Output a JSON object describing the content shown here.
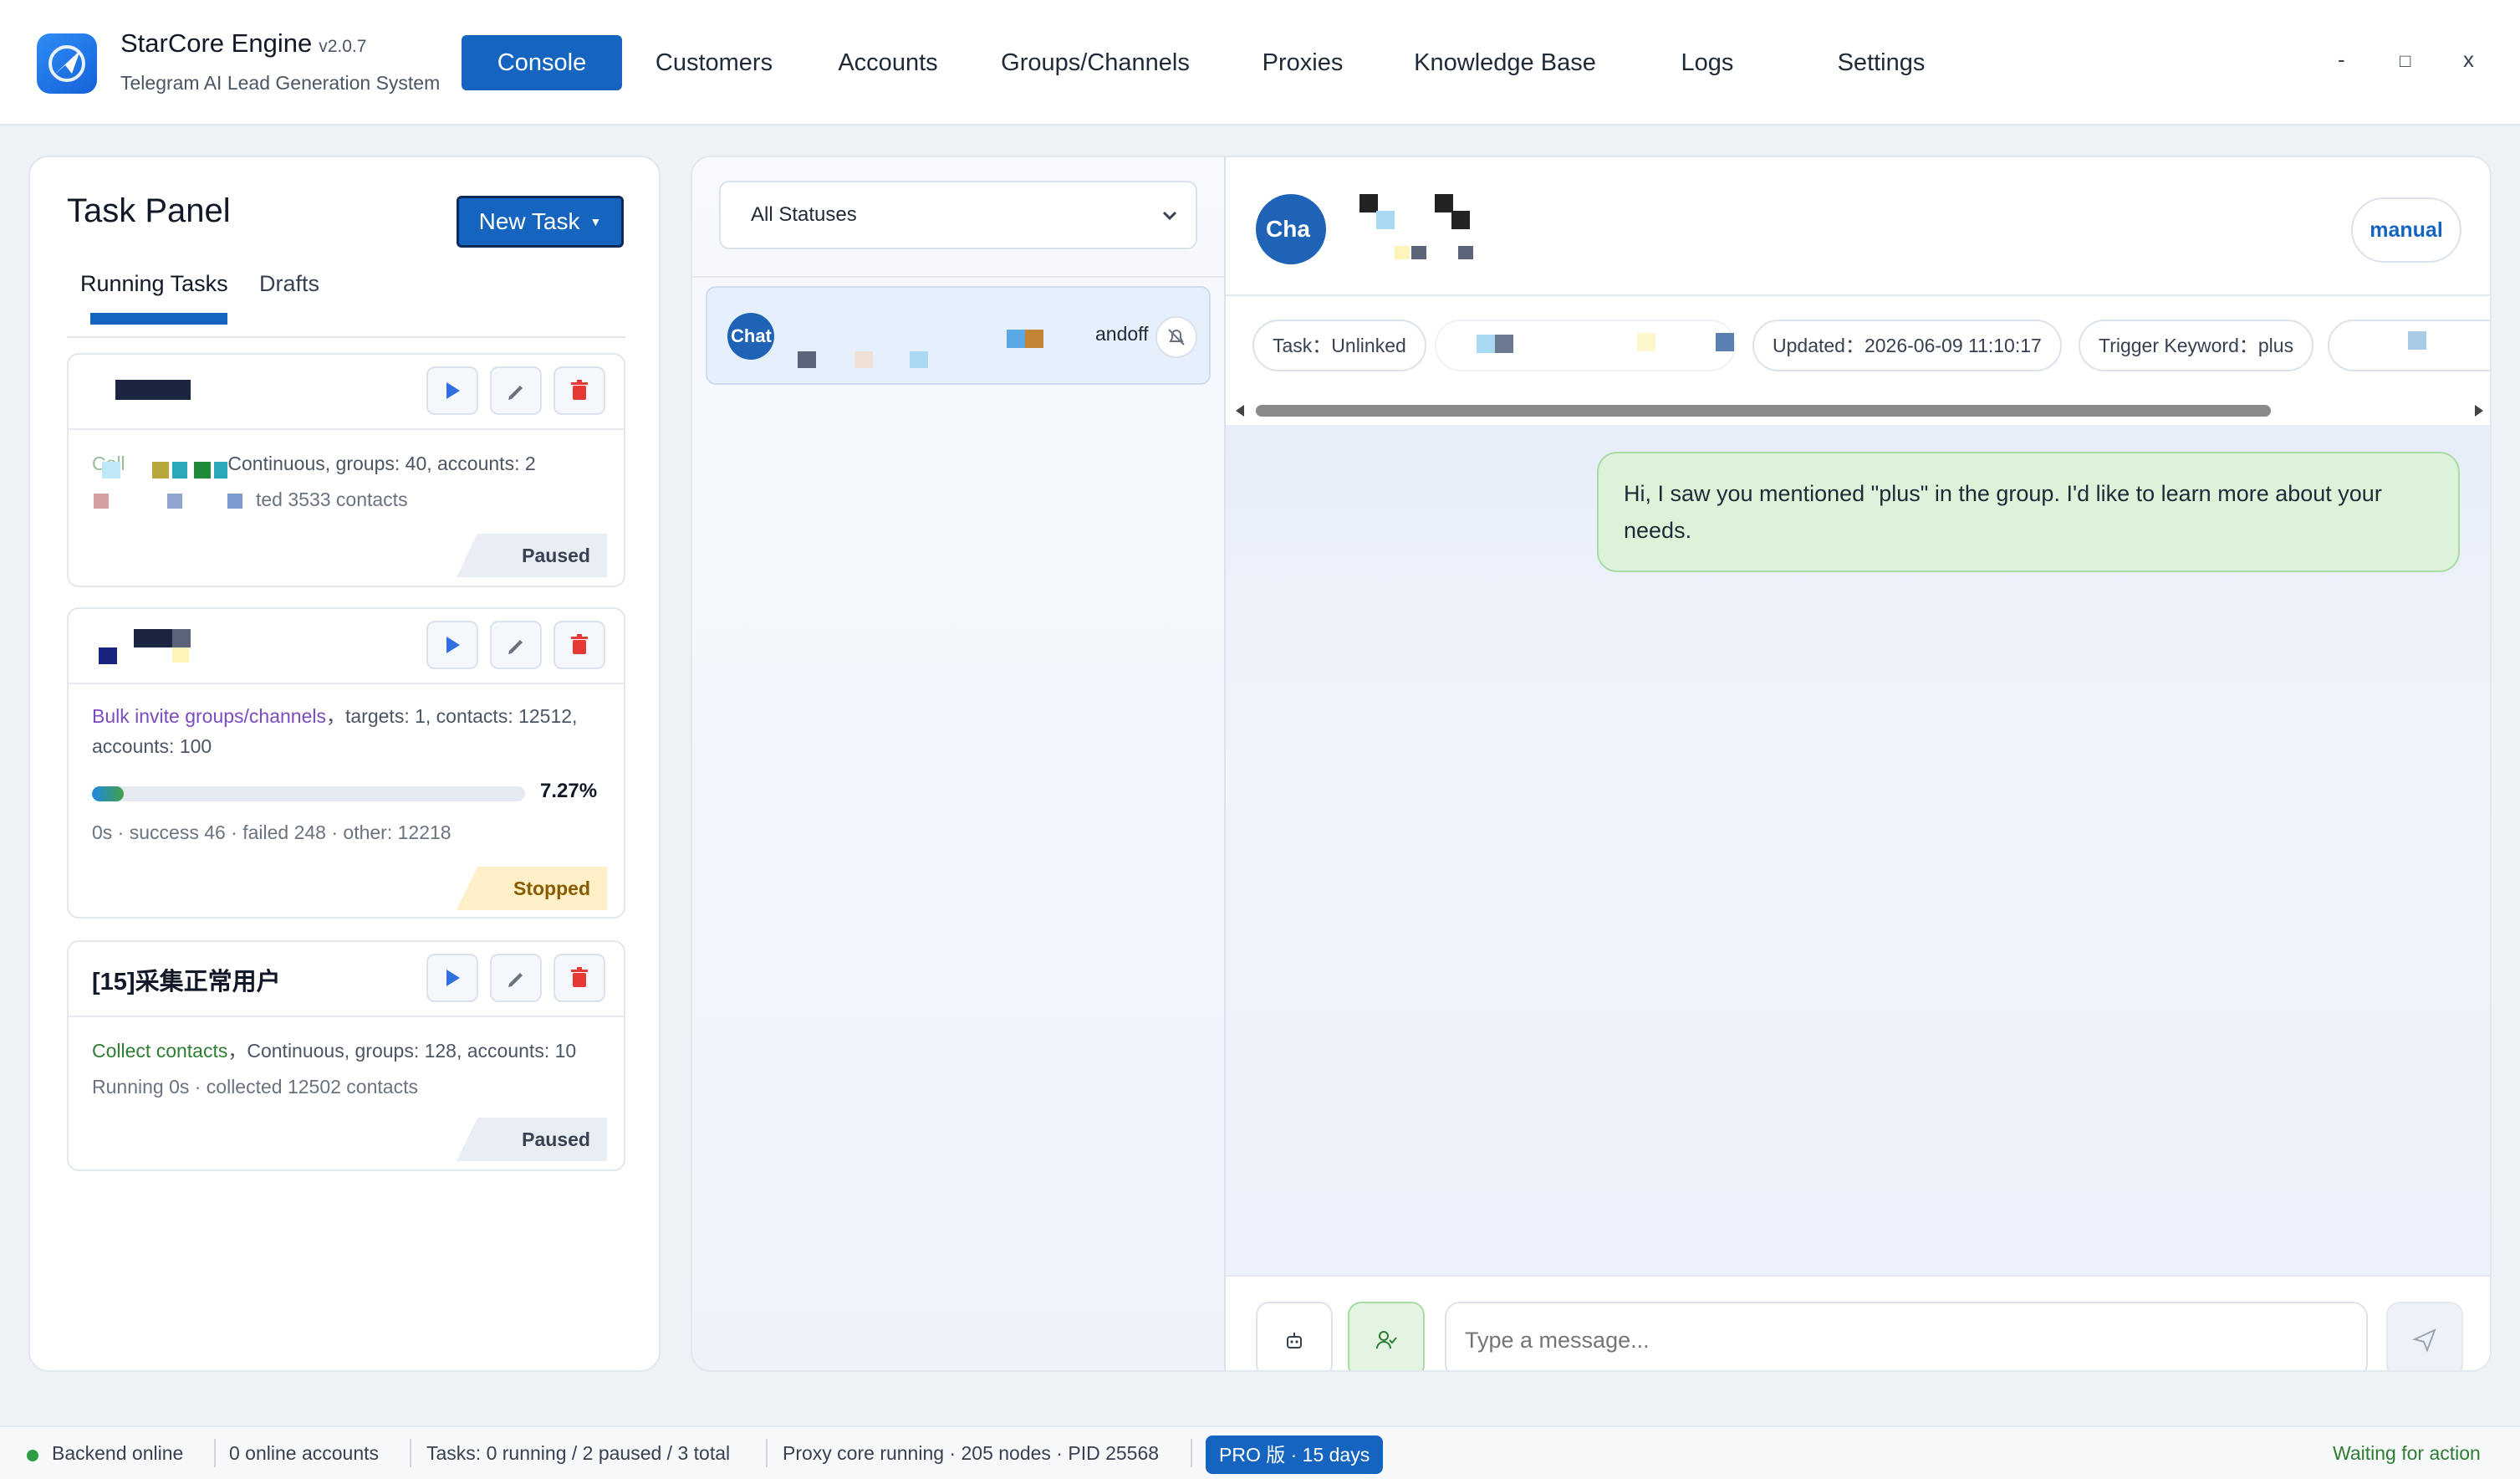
{
  "app": {
    "name": "StarCore Engine",
    "version": "v2.0.7",
    "subtitle": "Telegram AI Lead Generation System"
  },
  "nav": {
    "items": [
      {
        "label": "Console",
        "active": true
      },
      {
        "label": "Customers"
      },
      {
        "label": "Accounts"
      },
      {
        "label": "Groups/Channels"
      },
      {
        "label": "Proxies"
      },
      {
        "label": "Knowledge Base"
      },
      {
        "label": "Logs"
      },
      {
        "label": "Settings"
      }
    ]
  },
  "window_controls": {
    "minimize": "-",
    "maximize": "□",
    "close": "x"
  },
  "task_panel": {
    "title": "Task Panel",
    "new_task_label": "New Task",
    "new_task_caret": "▼",
    "tabs": [
      {
        "label": "Running Tasks",
        "active": true
      },
      {
        "label": "Drafts"
      }
    ],
    "tasks": [
      {
        "title": "",
        "line1_prefix": "Coll",
        "line1_rest": "Continuous, groups: 40, accounts: 2",
        "line2": "ted 3533 contacts",
        "status": "Paused"
      },
      {
        "title": "",
        "type": "Bulk invite groups/channels",
        "line1_rest": "，targets: 1, contacts: 12512,",
        "line1b": "accounts: 100",
        "progress": 7.27,
        "progress_label": "7.27%",
        "stats": "0s · success 46 · failed 248 · other: 12218",
        "status": "Stopped"
      },
      {
        "title": "[15]采集正常用户",
        "type": "Collect contacts",
        "line1_rest": "，Continuous, groups: 128, accounts: 10",
        "line2": "Running 0s · collected 12502 contacts",
        "status": "Paused"
      }
    ]
  },
  "conversations": {
    "filter": {
      "selected": "All Statuses"
    },
    "items": [
      {
        "avatar_text": "Chat",
        "mode": "andoff"
      }
    ]
  },
  "chat": {
    "avatar_text": "Cha",
    "mode": "manual",
    "chips": {
      "task": "Task：Unlinked",
      "updated": "Updated：2026-06-09 11:10:17",
      "trigger": "Trigger Keyword：plus"
    },
    "messages": [
      {
        "direction": "outgoing",
        "text": "Hi, I saw you mentioned \"plus\" in the group. I'd like to learn more about your needs."
      }
    ],
    "input_placeholder": "Type a message..."
  },
  "statusbar": {
    "backend": "Backend online",
    "accounts": "0 online accounts",
    "tasks": "Tasks: 0 running / 2 paused / 3 total",
    "proxy": "Proxy core running · 205 nodes · PID 25568",
    "license": "PRO 版 · 15 days",
    "right": "Waiting for action"
  },
  "colors": {
    "accent": "#1565c0",
    "backend_online": "#2e9e44",
    "paused_tag": "#e9eef5",
    "stopped_tag": "#fdefc6",
    "outgoing_bubble": "#dcf3da",
    "waiting_text": "#2e7d32"
  }
}
